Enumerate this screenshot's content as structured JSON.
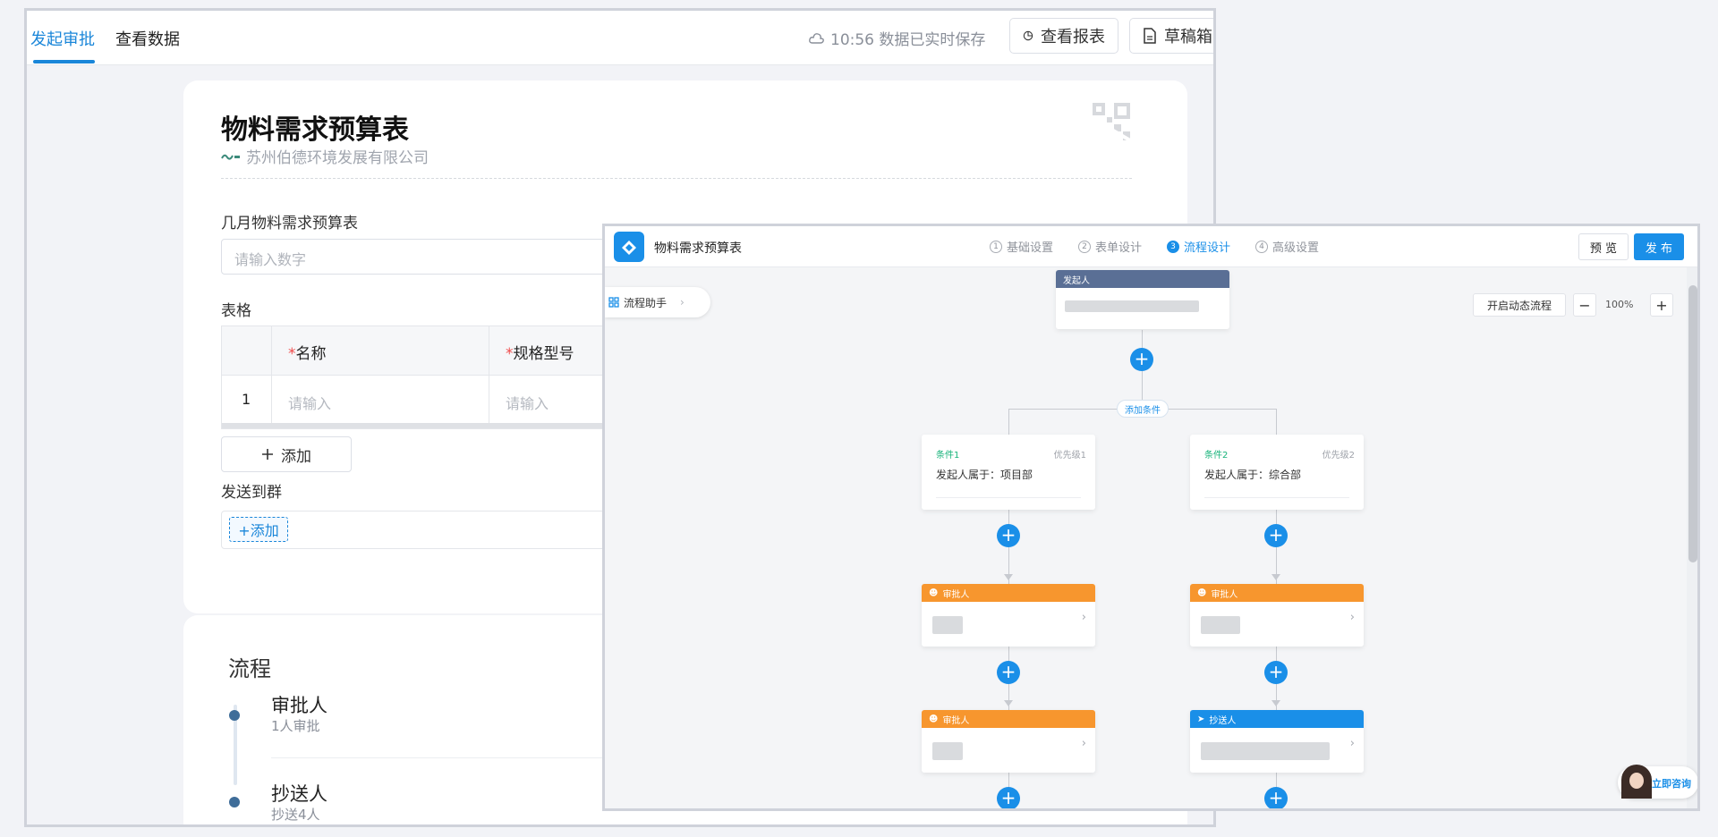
{
  "back_window": {
    "tabs": [
      {
        "label": "发起审批",
        "active": true
      },
      {
        "label": "查看数据",
        "active": false
      }
    ],
    "save_status": "10:56 数据已实时保存",
    "report_button": "查看报表",
    "drafts_button": "草稿箱",
    "form": {
      "title": "物料需求预算表",
      "company": "苏州伯德环境发展有限公司",
      "month_field": {
        "label": "几月物料需求预算表",
        "placeholder": "请输入数字"
      },
      "table": {
        "label": "表格",
        "columns": [
          "名称",
          "规格型号"
        ],
        "row_index": "1",
        "cell_placeholder": "请输入",
        "add_button": "添加"
      },
      "send_to_group": {
        "label": "发送到群",
        "add_button": "+添加"
      }
    },
    "flow": {
      "title": "流程",
      "steps": [
        {
          "name": "审批人",
          "sub": "1人审批"
        },
        {
          "name": "抄送人",
          "sub": "抄送4人"
        }
      ]
    }
  },
  "front_window": {
    "app_title": "物料需求预算表",
    "steps": [
      {
        "num": "1",
        "label": "基础设置",
        "active": false
      },
      {
        "num": "2",
        "label": "表单设计",
        "active": false
      },
      {
        "num": "3",
        "label": "流程设计",
        "active": true
      },
      {
        "num": "4",
        "label": "高级设置",
        "active": false
      }
    ],
    "preview_button": "预 览",
    "publish_button": "发 布",
    "helper": "流程助手",
    "dynamic_flow_button": "开启动态流程",
    "zoom": "100%",
    "initiator_label": "发起人",
    "add_condition": "添加条件",
    "conditions": [
      {
        "name": "条件1",
        "priority": "优先级1",
        "text": "发起人属于：项目部"
      },
      {
        "name": "条件2",
        "priority": "优先级2",
        "text": "发起人属于：综合部"
      }
    ],
    "approver_label": "审批人",
    "cc_label": "抄送人",
    "consult": "立即咨询"
  },
  "colors": {
    "accent": "#1a86d9",
    "approver_orange": "#f7962e",
    "initiator_header": "#5a6f95",
    "condition_green": "#17b37a"
  }
}
